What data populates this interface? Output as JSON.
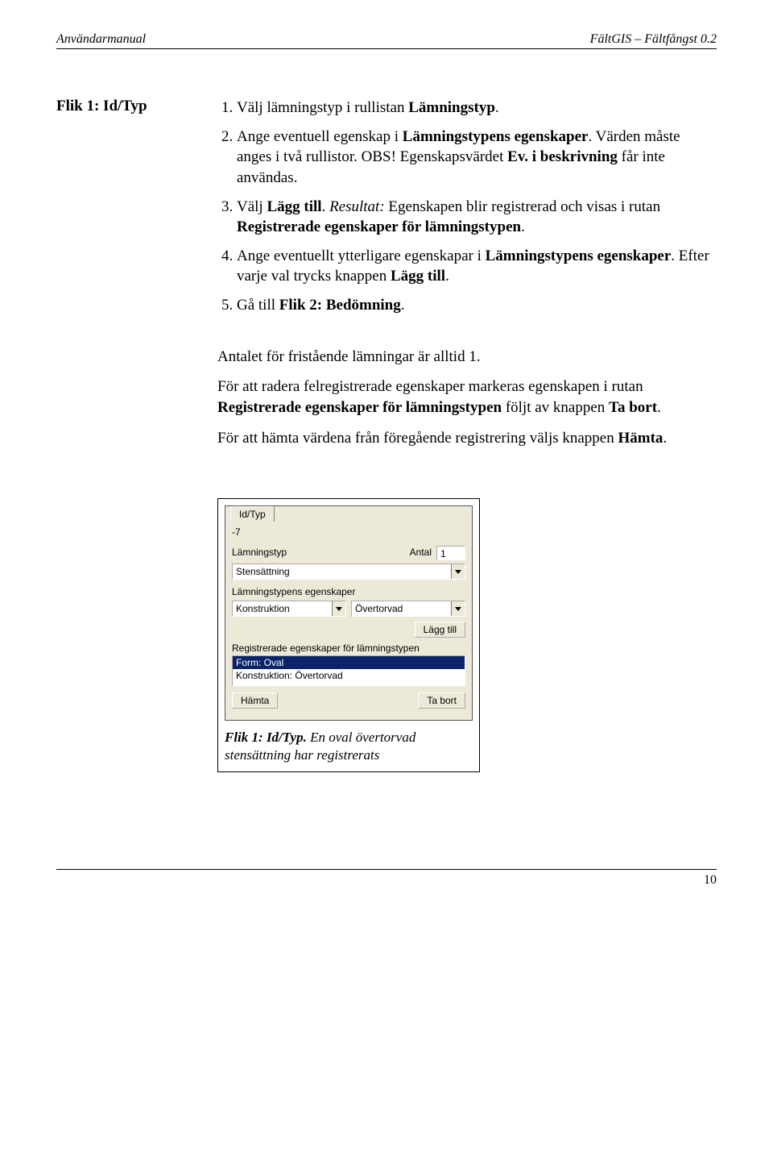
{
  "header": {
    "left": "Användarmanual",
    "right": "FältGIS – Fältfångst 0.2"
  },
  "side_heading": "Flik 1: Id/Typ",
  "steps": [
    "Välj lämningstyp i rullistan <b>Lämningstyp</b>.",
    "Ange eventuell egenskap i <b>Lämningstypens egenskaper</b>. Värden måste anges i två rullistor. OBS! Egenskapsvärdet <b>Ev. i beskrivning</b> får inte användas.",
    "Välj <b>Lägg till</b>. <i>Resultat:</i> Egenskapen blir registrerad och visas i rutan <b>Registrerade egenskaper för lämningstypen</b>.",
    "Ange eventuellt ytterligare egenskapar i <b>Lämningstypens egenskaper</b>. Efter varje val trycks knappen <b>Lägg till</b>.",
    "Gå till <b>Flik 2: Bedömning</b>."
  ],
  "paras": [
    "Antalet för fristående lämningar är alltid 1.",
    "För att radera felregistrerade egenskaper markeras egenskapen i rutan <b>Registrerade egenskaper för lämningstypen</b> följt av knappen <b>Ta bort</b>.",
    "För att hämta värdena från föregående registrering väljs knappen <b>Hämta</b>."
  ],
  "mock": {
    "tab": "Id/Typ",
    "idval": "-7",
    "lbl_lamningstyp": "Lämningstyp",
    "lbl_antal": "Antal",
    "antal_val": "1",
    "sel_lamningstyp": "Stensättning",
    "lbl_egenskaper": "Lämningstypens egenskaper",
    "sel_eg1": "Konstruktion",
    "sel_eg2": "Övertorvad",
    "btn_lagg": "Lägg till",
    "lbl_reg": "Registrerade egenskaper för lämningstypen",
    "list_item1": "Form: Oval",
    "list_item2": "Konstruktion: Övertorvad",
    "btn_hamta": "Hämta",
    "btn_tabort": "Ta bort"
  },
  "caption_prefix_italic": "Flik 1: Id/Typ.",
  "caption_rest": " En oval övertorvad stensättning har registrerats",
  "page_number": "10"
}
